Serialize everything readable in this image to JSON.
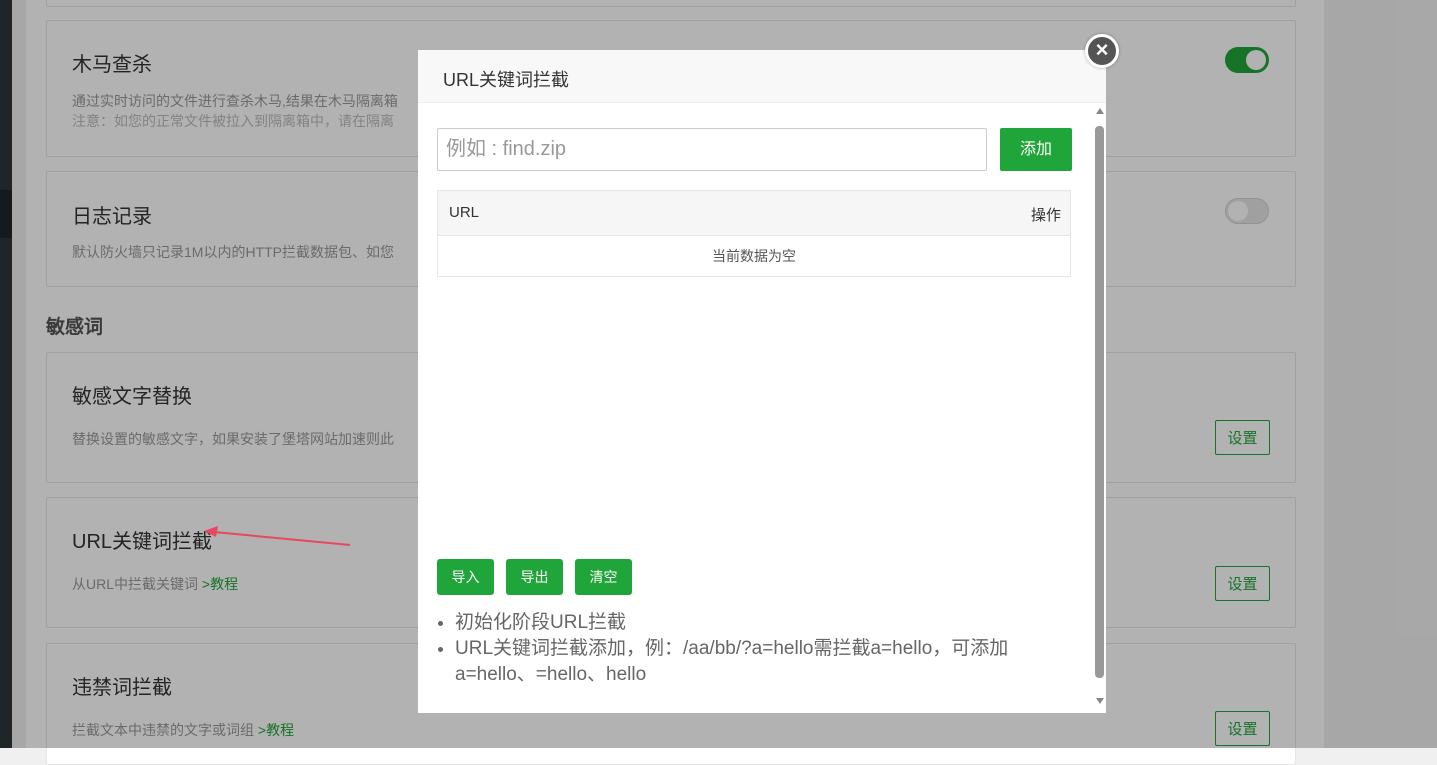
{
  "page": {
    "cards": {
      "trojan": {
        "title": "木马查杀",
        "desc": "通过实时访问的文件进行查杀木马,结果在木马隔离箱",
        "note": "注意：如您的正常文件被拉入到隔离箱中，请在隔离"
      },
      "log": {
        "title": "日志记录",
        "desc": "默认防火墙只记录1M以内的HTTP拦截数据包、如您"
      },
      "sensitive_replace": {
        "title": "敏感文字替换",
        "desc": "替换设置的敏感文字，如果安装了堡塔网站加速则此",
        "button": "设置"
      },
      "url_block": {
        "title": "URL关键词拦截",
        "desc": "从URL中拦截关键词",
        "link": ">教程",
        "button": "设置"
      },
      "banned_words": {
        "title": "违禁词拦截",
        "desc": "拦截文本中违禁的文字或词组",
        "link": ">教程",
        "button": "设置"
      }
    },
    "section_title": "敏感词",
    "toggles": {
      "trojan": "on",
      "log": "off"
    }
  },
  "modal": {
    "title": "URL关键词拦截",
    "close_icon": "close-icon",
    "input_placeholder": "例如 : find.zip",
    "add_button": "添加",
    "table": {
      "columns": [
        "URL",
        "操作"
      ],
      "empty_text": "当前数据为空"
    },
    "buttons": {
      "import": "导入",
      "export": "导出",
      "clear": "清空"
    },
    "tips": [
      "初始化阶段URL拦截",
      "URL关键词拦截添加，例：/aa/bb/?a=hello需拦截a=hello，可添加a=hello、=hello、hello"
    ]
  },
  "colors": {
    "accent": "#20a53a",
    "overlay": "rgba(0,0,0,0.3)",
    "sidebar": "#2f353a"
  }
}
